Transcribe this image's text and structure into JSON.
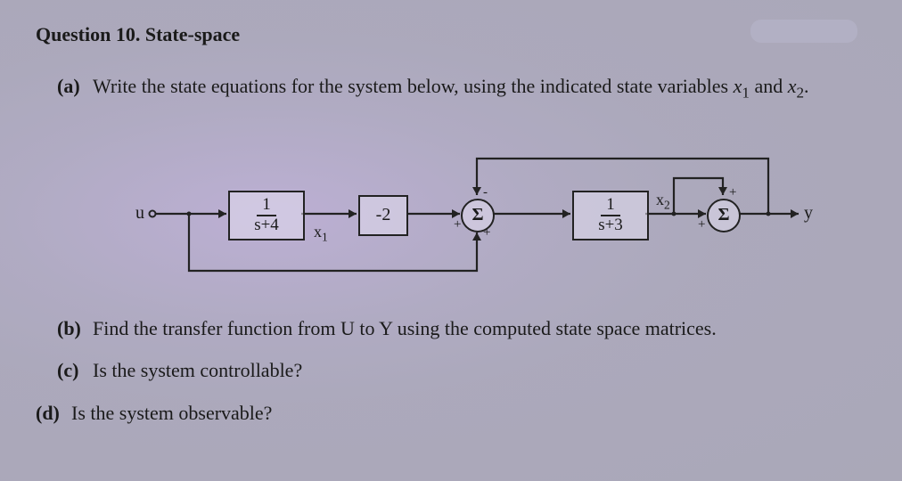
{
  "title": "Question 10. State-space",
  "parts": {
    "a": {
      "label": "(a)",
      "text_pre": "Write the state equations for the system below, using the indicated state variables ",
      "var1": "x",
      "var1_sub": "1",
      "text_mid": " and ",
      "var2": "x",
      "var2_sub": "2",
      "text_post": "."
    },
    "b": {
      "label": "(b)",
      "text": "Find the transfer function from U to Y using the computed state space matrices."
    },
    "c": {
      "label": "(c)",
      "text": "Is the system controllable?"
    },
    "d": {
      "label": "(d)",
      "text": "Is the system observable?"
    }
  },
  "diagram": {
    "input_label": "u",
    "output_label": "y",
    "block1": {
      "num": "1",
      "den": "s+4"
    },
    "state1_label": "x",
    "state1_sub": "1",
    "gain": "-2",
    "block2": {
      "num": "1",
      "den": "s+3"
    },
    "state2_label": "x",
    "state2_sub": "2",
    "summer_symbol": "Σ",
    "signs": {
      "sum1_top": "-",
      "sum1_left": "+",
      "sum1_bottom": "+",
      "sum2_top": "+",
      "sum2_left": "+"
    }
  }
}
